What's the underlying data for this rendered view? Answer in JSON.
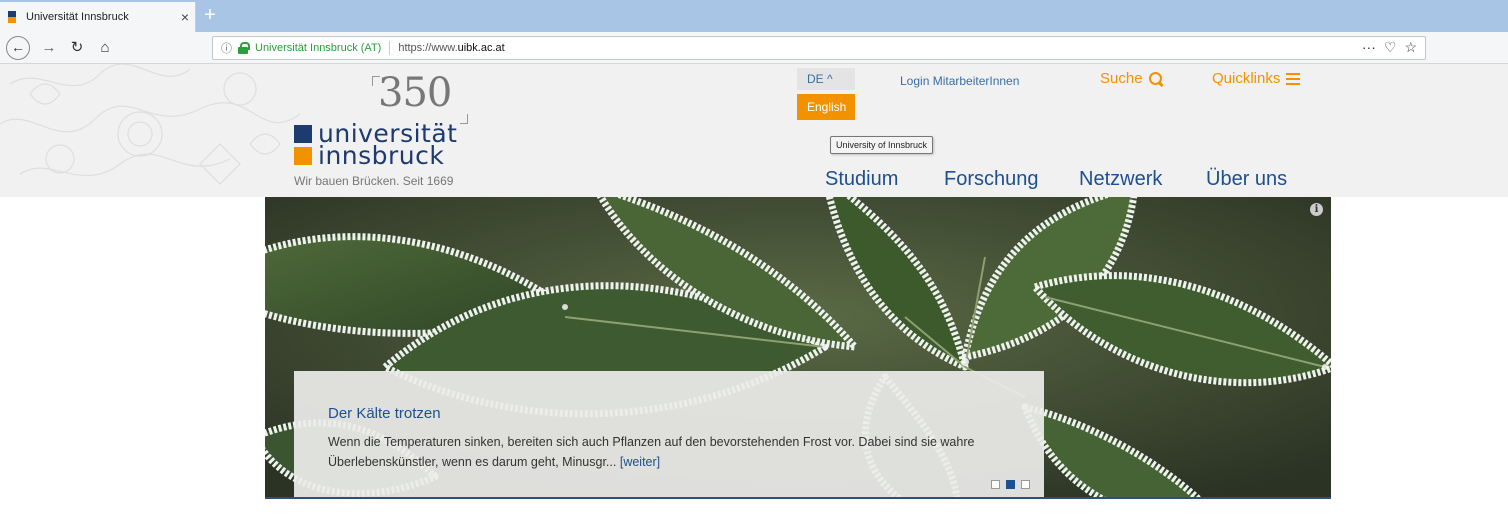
{
  "browser": {
    "tab_title": "Universität Innsbruck",
    "tab_close": "×",
    "new_tab": "+",
    "info_symbol": "ⓘ",
    "site_identity": "Universität Innsbruck (AT)",
    "url_prefix": "https://www.",
    "url_domain": "uibk.ac.at",
    "url_actions": {
      "more": "···",
      "pocket": "♡",
      "bookmark": "☆"
    }
  },
  "header": {
    "anniversary": "350",
    "logo_line1": "universität",
    "logo_line2": "innsbruck",
    "tagline": "Wir bauen Brücken. Seit 1669",
    "lang_current": "DE ^",
    "lang_alt": "English",
    "login": "Login MitarbeiterInnen",
    "search": "Suche",
    "quicklinks": "Quicklinks",
    "tooltip": "University of Innsbruck",
    "nav": [
      "Studium",
      "Forschung",
      "Netzwerk",
      "Über uns"
    ]
  },
  "hero": {
    "info_badge": "i",
    "title": "Der Kälte trotzen",
    "text": "Wenn die Temperaturen sinken, bereiten sich auch Pflanzen auf den bevorstehenden Frost vor. Dabei sind sie wahre Überlebenskünstler, wenn es darum geht, Minusgr...",
    "more": "[weiter]",
    "slide_count": 3,
    "active_slide": 2
  },
  "colors": {
    "brand_blue": "#1d3b6e",
    "brand_orange": "#f39200",
    "link_blue": "#1d4f91"
  }
}
